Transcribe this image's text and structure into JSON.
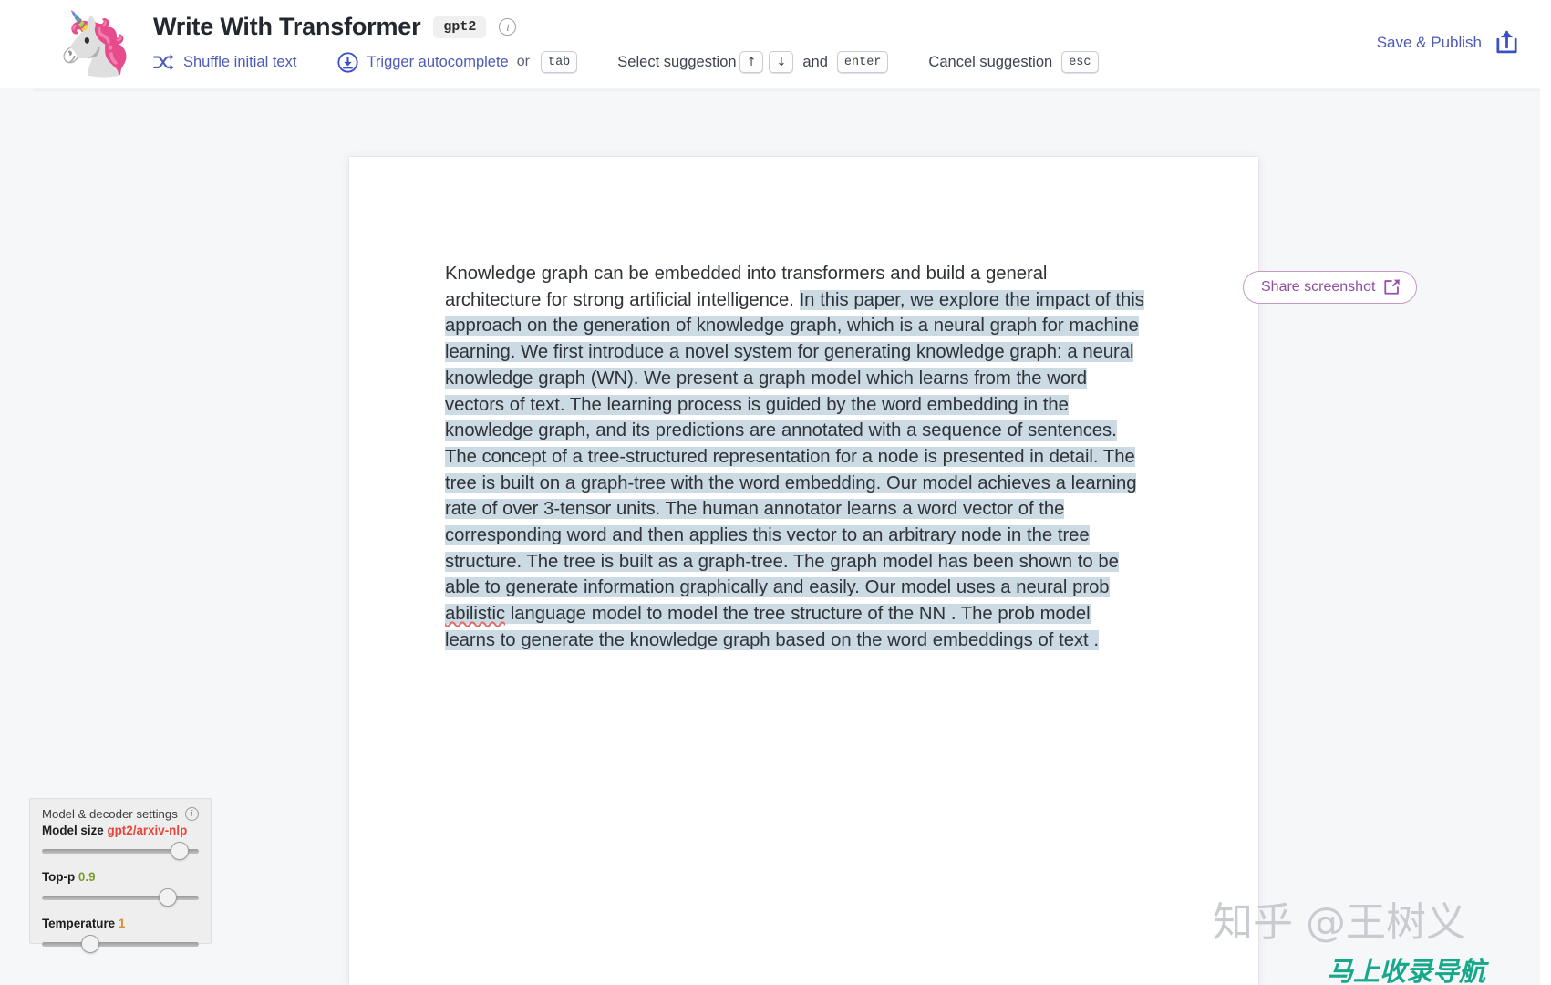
{
  "header": {
    "logo_icon": "unicorn-emoji",
    "logo_glyph": "🦄",
    "title": "Write With Transformer",
    "model_badge": "gpt2",
    "info_glyph": "i",
    "shortcuts": {
      "shuffle_label": "Shuffle initial text",
      "autocomplete_label": "Trigger autocomplete",
      "or_label": "or",
      "tab_key": "tab",
      "select_label": "Select suggestion",
      "arrow_up_key": "↑",
      "arrow_down_key": "↓",
      "and_label": "and",
      "enter_key": "enter",
      "cancel_label": "Cancel suggestion",
      "esc_key": "esc"
    },
    "save_label": "Save & Publish",
    "save_icon": "upload-icon"
  },
  "editor": {
    "prompt_text": "Knowledge graph can be embedded into transformers and build a general architecture for strong artificial intelligence. ",
    "generated_part_1": " In this paper, we explore the impact of this approach on the generation of knowledge graph, which is a neural graph for machine learning. We first introduce a novel system for generating knowledge graph: a neural knowledge graph (WN).  We present a graph model which learns from the word vectors of text. The learning process is guided by the word embedding in the knowledge graph, and its predictions are annotated with  a sequence of sentences. The concept of a tree-structured representation for a node is presented in detail. The tree is built on a graph-tree with the word embedding. Our model achieves a learning rate of over 3-tensor units. The human annotator learns a word vector of the corresponding  word and then applies this vector to an arbitrary node in the tree structure. The tree is built as a graph-tree. The graph model has been shown to be able to generate information graphically and easily. Our model uses a neural prob ",
    "misspelled_word": "abilistic",
    "generated_part_2": " language model to model the tree structure of the NN . The prob model learns  to generate the knowledge graph based on the word embeddings of text ."
  },
  "share": {
    "label": "Share screenshot",
    "icon": "external-link-icon"
  },
  "settings": {
    "panel_title": "Model & decoder settings",
    "info_glyph": "i",
    "rows": [
      {
        "label": "Model size",
        "value": "gpt2/arxiv-nlp",
        "thumb_pct": 93
      },
      {
        "label": "Top-p",
        "value": "0.9",
        "thumb_pct": 84
      },
      {
        "label": "Temperature",
        "value": "1",
        "thumb_pct": 28
      }
    ]
  },
  "watermark": {
    "zhihu": "知乎 @王树义",
    "nav": "马上收录导航"
  },
  "colors": {
    "accent_blue": "#4c5bb8",
    "generated_highlight": "#ccdae4",
    "share_purple": "#8f4ea0",
    "model_value_red": "#e8443a",
    "topp_value_green": "#7a9b2e",
    "temp_value_orange": "#e08a2e",
    "page_bg": "#f6f7f9"
  }
}
